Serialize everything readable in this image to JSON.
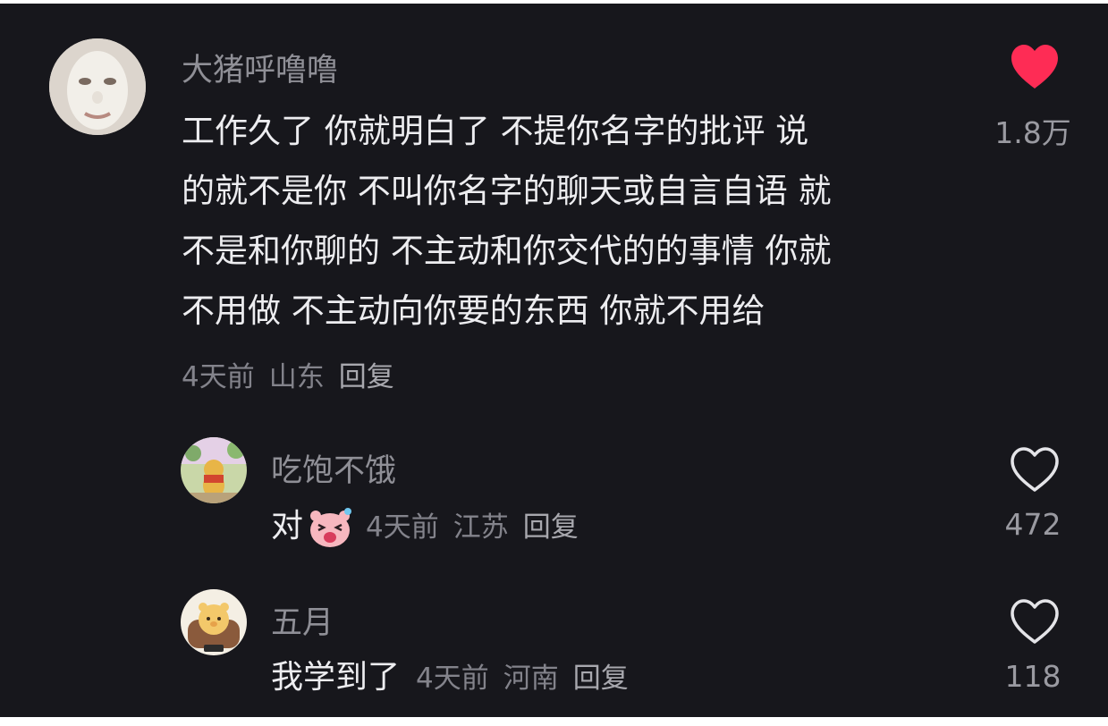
{
  "comment": {
    "username": "大猪呼噜噜",
    "text_lines": [
      "工作久了 你就明白了 不提你名字的批评 说",
      "的就不是你 不叫你名字的聊天或自言自语 就",
      "不是和你聊的 不主动和你交代的的事情 你就",
      "不用做 不主动向你要的东西 你就不用给"
    ],
    "time": "4天前",
    "location": "山东",
    "reply_label": "回复",
    "like_count": "1.8万",
    "liked": true,
    "like_color": "#fe2c55"
  },
  "replies": [
    {
      "username": "吃饱不饿",
      "text": "对",
      "emoji": "laughing-pig-emoji",
      "time": "4天前",
      "location": "江苏",
      "reply_label": "回复",
      "like_count": "472"
    },
    {
      "username": "五月",
      "text": "我学到了",
      "time": "4天前",
      "location": "河南",
      "reply_label": "回复",
      "like_count": "118"
    }
  ]
}
